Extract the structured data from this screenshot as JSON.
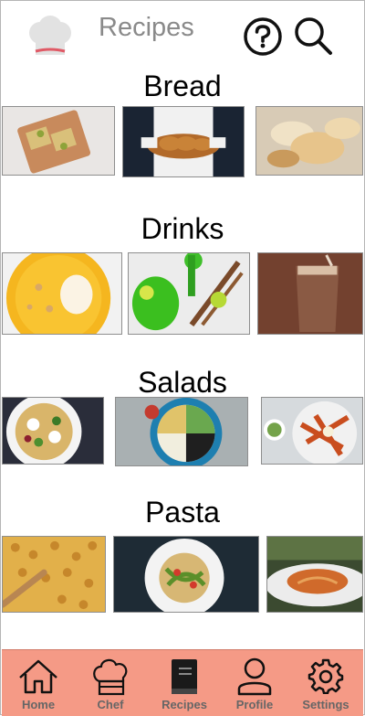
{
  "header": {
    "title": "Recipes",
    "logo_icon": "chef-hat-icon",
    "help_icon": "help-icon",
    "search_icon": "search-icon"
  },
  "sections": [
    {
      "title": "Bread",
      "images": [
        "crackers-on-board",
        "chef-holding-braided-bread",
        "sliced-baguette"
      ]
    },
    {
      "title": "Drinks",
      "images": [
        "mango-lassi-bowl",
        "green-lime-drink",
        "chocolate-milkshake"
      ]
    },
    {
      "title": "Salads",
      "images": [
        "pasta-salad-plate",
        "grain-bowl-salad",
        "sweet-potato-salad"
      ]
    },
    {
      "title": "Pasta",
      "images": [
        "macaroni-with-fork",
        "pasta-with-vegetables",
        "spaghetti-on-plate"
      ]
    }
  ],
  "tabbar": {
    "items": [
      {
        "label": "Home",
        "icon": "home-icon"
      },
      {
        "label": "Chef",
        "icon": "chef-hat-icon"
      },
      {
        "label": "Recipes",
        "icon": "book-icon",
        "active": true
      },
      {
        "label": "Profile",
        "icon": "user-icon"
      },
      {
        "label": "Settings",
        "icon": "gear-icon"
      }
    ]
  },
  "colors": {
    "tabbar_bg": "#f59a86",
    "title_gray": "#8a8a8a",
    "logo_band": "#e05a66"
  }
}
